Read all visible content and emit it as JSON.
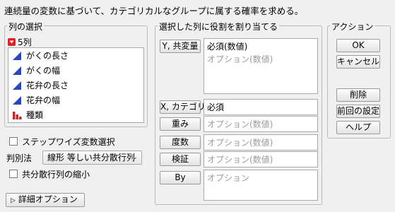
{
  "description": "連続量の変数に基づいて、カテゴリカルなグループに属する確率を求める。",
  "column_selection": {
    "title": "列の選択",
    "count_label": "5列",
    "columns": [
      {
        "label": "がくの長さ",
        "icon": "continuous-icon"
      },
      {
        "label": "がくの幅",
        "icon": "continuous-icon"
      },
      {
        "label": "花弁の長さ",
        "icon": "continuous-icon"
      },
      {
        "label": "花弁の幅",
        "icon": "continuous-icon"
      },
      {
        "label": "種類",
        "icon": "nominal-icon"
      }
    ]
  },
  "roles": {
    "title": "選択した列に役割を割り当てる",
    "y": {
      "button": "Y, 共変量",
      "required": "必須(数値)",
      "optional": "オプション(数値)"
    },
    "x": {
      "button": "X, カテゴリ",
      "value": "必須"
    },
    "weight": {
      "button": "重み",
      "value": "オプション(数値)"
    },
    "freq": {
      "button": "度数",
      "value": "オプション(数値)"
    },
    "validation": {
      "button": "検証",
      "value": "オプション(数値)"
    },
    "by": {
      "button": "By",
      "value": "オプション"
    }
  },
  "actions": {
    "title": "アクション",
    "ok": "OK",
    "cancel": "キャンセル",
    "remove": "削除",
    "recall": "前回の設定",
    "help": "ヘルプ"
  },
  "options": {
    "stepwise_label": "ステップワイズ変数選択",
    "stepwise_checked": false,
    "method_label": "判別法",
    "method_value": "線形 等しい共分散行列",
    "shrink_label": "共分散行列の縮小",
    "shrink_checked": false,
    "advanced_label": "詳細オプション"
  },
  "colors": {
    "continuous": "#2a46b8",
    "nominal": "#c0282b",
    "disclosure": "#d9232a"
  }
}
